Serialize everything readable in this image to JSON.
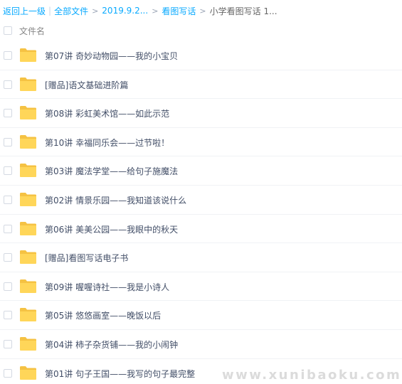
{
  "breadcrumb": {
    "back": "返回上一级",
    "all_files": "全部文件",
    "folder1": "2019.9.2...",
    "folder2": "看图写话",
    "current": "小学看图写话 1...",
    "bar_separator": "|",
    "separator": ">"
  },
  "header": {
    "column_name": "文件名"
  },
  "files": [
    {
      "name": "第07讲 奇妙动物园——我的小宝贝"
    },
    {
      "name": "[赠品]语文基础进阶篇"
    },
    {
      "name": "第08讲 彩虹美术馆——如此示范"
    },
    {
      "name": "第10讲 幸福同乐会——过节啦！"
    },
    {
      "name": "第03讲 魔法学堂——给句子施魔法"
    },
    {
      "name": "第02讲 情景乐园——我知道该说什么"
    },
    {
      "name": "第06讲 美美公园——我眼中的秋天"
    },
    {
      "name": "[赠品]看图写话电子书"
    },
    {
      "name": "第09讲 喔喔诗社——我是小诗人"
    },
    {
      "name": "第05讲 悠悠画室——晚饭以后"
    },
    {
      "name": "第04讲 柿子杂货铺——我的小闹钟"
    },
    {
      "name": "第01讲 句子王国——我写的句子最完整"
    }
  ],
  "watermark": "www.xunibaoku.com",
  "colors": {
    "link": "#09aaff",
    "folder": "#ffd659",
    "folder_tab": "#f5c243",
    "text": "#424e67"
  }
}
